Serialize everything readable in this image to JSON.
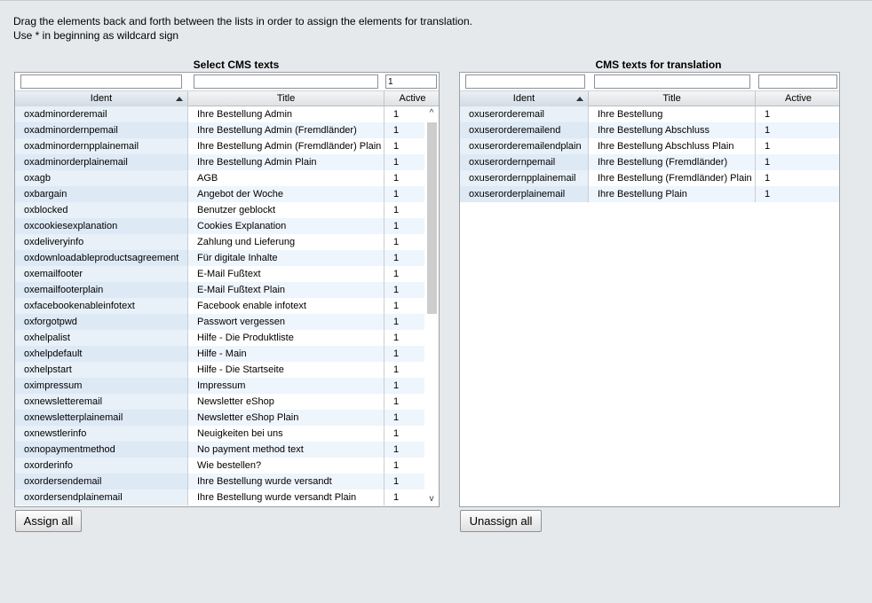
{
  "instructions": {
    "line1": "Drag the elements back and forth between the lists in order to assign the elements for translation.",
    "line2": "Use * in beginning as wildcard sign"
  },
  "left": {
    "title": "Select CMS texts",
    "filters": {
      "ident": "",
      "title": "",
      "active": "1"
    },
    "columns": {
      "ident": "Ident",
      "title": "Title",
      "active": "Active"
    },
    "rows": [
      {
        "ident": "oxadminorderemail",
        "title": "Ihre Bestellung Admin",
        "active": "1"
      },
      {
        "ident": "oxadminordernpemail",
        "title": "Ihre Bestellung Admin (Fremdländer)",
        "active": "1"
      },
      {
        "ident": "oxadminordernpplainemail",
        "title": "Ihre Bestellung Admin (Fremdländer) Plain",
        "active": "1"
      },
      {
        "ident": "oxadminorderplainemail",
        "title": "Ihre Bestellung Admin Plain",
        "active": "1"
      },
      {
        "ident": "oxagb",
        "title": "AGB",
        "active": "1"
      },
      {
        "ident": "oxbargain",
        "title": "Angebot der Woche",
        "active": "1"
      },
      {
        "ident": "oxblocked",
        "title": "Benutzer geblockt",
        "active": "1"
      },
      {
        "ident": "oxcookiesexplanation",
        "title": "Cookies Explanation",
        "active": "1"
      },
      {
        "ident": "oxdeliveryinfo",
        "title": "Zahlung und Lieferung",
        "active": "1"
      },
      {
        "ident": "oxdownloadableproductsagreement",
        "title": "Für digitale Inhalte",
        "active": "1"
      },
      {
        "ident": "oxemailfooter",
        "title": "E-Mail Fußtext",
        "active": "1"
      },
      {
        "ident": "oxemailfooterplain",
        "title": "E-Mail Fußtext Plain",
        "active": "1"
      },
      {
        "ident": "oxfacebookenableinfotext",
        "title": "Facebook enable infotext",
        "active": "1"
      },
      {
        "ident": "oxforgotpwd",
        "title": "Passwort vergessen",
        "active": "1"
      },
      {
        "ident": "oxhelpalist",
        "title": "Hilfe - Die Produktliste",
        "active": "1"
      },
      {
        "ident": "oxhelpdefault",
        "title": "Hilfe - Main",
        "active": "1"
      },
      {
        "ident": "oxhelpstart",
        "title": "Hilfe - Die Startseite",
        "active": "1"
      },
      {
        "ident": "oximpressum",
        "title": "Impressum",
        "active": "1"
      },
      {
        "ident": "oxnewsletteremail",
        "title": "Newsletter eShop",
        "active": "1"
      },
      {
        "ident": "oxnewsletterplainemail",
        "title": "Newsletter eShop Plain",
        "active": "1"
      },
      {
        "ident": "oxnewstlerinfo",
        "title": "Neuigkeiten bei uns",
        "active": "1"
      },
      {
        "ident": "oxnopaymentmethod",
        "title": "No payment method text",
        "active": "1"
      },
      {
        "ident": "oxorderinfo",
        "title": "Wie bestellen?",
        "active": "1"
      },
      {
        "ident": "oxordersendemail",
        "title": "Ihre Bestellung wurde versandt",
        "active": "1"
      },
      {
        "ident": "oxordersendplainemail",
        "title": "Ihre Bestellung wurde versandt Plain",
        "active": "1"
      }
    ],
    "scroll_up": "^",
    "scroll_down": "v",
    "button": "Assign all"
  },
  "right": {
    "title": "CMS texts for translation",
    "filters": {
      "ident": "",
      "title": "",
      "active": ""
    },
    "columns": {
      "ident": "Ident",
      "title": "Title",
      "active": "Active"
    },
    "rows": [
      {
        "ident": "oxuserorderemail",
        "title": "Ihre Bestellung",
        "active": "1"
      },
      {
        "ident": "oxuserorderemailend",
        "title": "Ihre Bestellung Abschluss",
        "active": "1"
      },
      {
        "ident": "oxuserorderemailendplain",
        "title": "Ihre Bestellung Abschluss Plain",
        "active": "1"
      },
      {
        "ident": "oxuserordernpemail",
        "title": "Ihre Bestellung (Fremdländer)",
        "active": "1"
      },
      {
        "ident": "oxuserordernpplainemail",
        "title": "Ihre Bestellung (Fremdländer) Plain",
        "active": "1"
      },
      {
        "ident": "oxuserorderplainemail",
        "title": "Ihre Bestellung Plain",
        "active": "1"
      }
    ],
    "button": "Unassign all"
  }
}
